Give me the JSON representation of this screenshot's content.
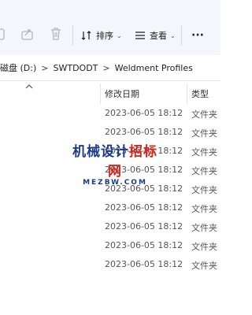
{
  "toolbar": {
    "sort_label": "排序",
    "view_label": "查看",
    "more_label": "···"
  },
  "breadcrumb": {
    "drive": "磁盘 (D:)",
    "folder1": "SWTDODT",
    "folder2": "Weldment Profiles",
    "separator": ">"
  },
  "columns": {
    "date_modified": "修改日期",
    "type": "类型"
  },
  "rows": [
    {
      "date": "2023-06-05 18:12",
      "type": "文件夹"
    },
    {
      "date": "2023-06-05 18:12",
      "type": "文件夹"
    },
    {
      "date": "2023-06-05 18:12",
      "type": "文件夹"
    },
    {
      "date": "2023-06-05 18:12",
      "type": "文件夹"
    },
    {
      "date": "2023-06-05 18:12",
      "type": "文件夹"
    },
    {
      "date": "2023-06-05 18:12",
      "type": "文件夹"
    },
    {
      "date": "2023-06-05 18:12",
      "type": "文件夹"
    },
    {
      "date": "2023-06-05 18:12",
      "type": "文件夹"
    },
    {
      "date": "2023-06-05 18:12",
      "type": "文件夹"
    }
  ],
  "watermark": {
    "title_part1": "机械设计",
    "title_part2": "招标网",
    "url": "MEZBW.COM"
  },
  "colors": {
    "toolbar_bg": "#f3f6fb",
    "watermark_blue": "#1a3b8c",
    "watermark_red": "#d7261e"
  }
}
